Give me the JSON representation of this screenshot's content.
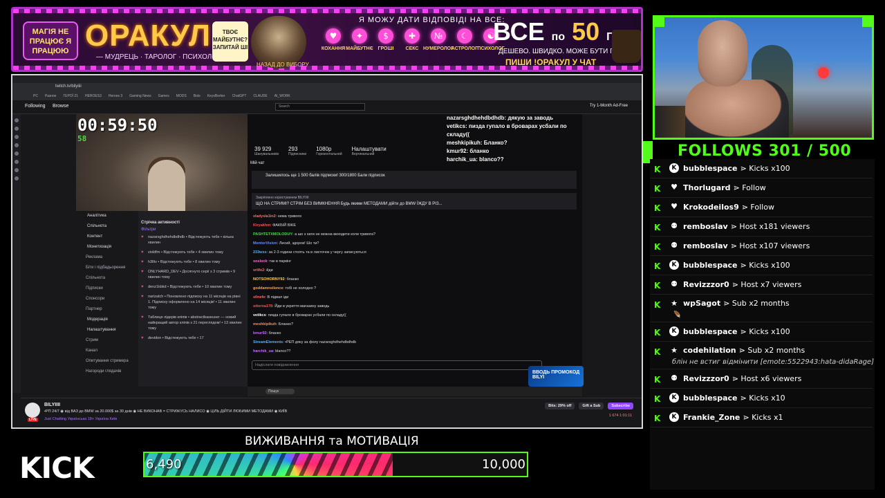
{
  "banner": {
    "magic_text": "МАГІЯ НЕ ПРАЦЮЄ Я ПРАЦЮЮ",
    "oracle": "ОРАКУЛ",
    "subtitle": "— МУДРЕЦЬ · ТАРОЛОГ · ПСИХОЛОГ —",
    "bubble": "ТВОЄ МАЙБУТНЄ? ЗАПИТАЙ ШІ",
    "wizard_label": "НАЗАД ДО ВИБОРУ",
    "answer": "Я МОЖУ ДАТИ ВІДПОВІДІ НА ВСЕ:",
    "categories": [
      "КОХАННЯ",
      "МАЙБУТНЄ",
      "ГРОШІ",
      "СЕКС",
      "НУМЕРОЛОГ",
      "АСТРОЛОГ",
      "ПСИХОЛОГ"
    ],
    "price_all": "ВСЕ",
    "price_po": "по",
    "price_num": "50",
    "price_grn": "ГРН.",
    "fast": "ДЕШЕВО. ШВИДКО. МОЖЕ БУТИ ПРАВДА.",
    "write": "ПИШИ !ОРАКУЛ У ЧАТ"
  },
  "screen": {
    "address": "twitch.tv/bilyiiii",
    "bookmarks": [
      "PC",
      "Разное",
      "ГЕРОЇ 21",
      "HEROES3",
      "Heroes 3",
      "Gaming News",
      "Games",
      "MODS",
      "Bots",
      "KeysBorker",
      "ChatGPT",
      "CLAUDE",
      "AI_WORK"
    ],
    "nav_following": "Following",
    "nav_browse": "Browse",
    "search_placeholder": "Search",
    "ad_free": "Try 1-Month Ad-Free",
    "timer": "00:59:50",
    "fps": "58",
    "menu": [
      {
        "label": "Аналітика",
        "sub": false
      },
      {
        "label": "Спільнота",
        "sub": false
      },
      {
        "label": "Контент",
        "sub": false
      },
      {
        "label": "Монетизація",
        "sub": false
      },
      {
        "label": "Реклама",
        "sub": true
      },
      {
        "label": "Біти і підбадьорення",
        "sub": true
      },
      {
        "label": "Спільнота",
        "sub": true
      },
      {
        "label": "Підписки",
        "sub": true
      },
      {
        "label": "Спонсори",
        "sub": true
      },
      {
        "label": "Партнер",
        "sub": true
      },
      {
        "label": "Модерація",
        "sub": false
      },
      {
        "label": "Налаштування",
        "sub": false
      },
      {
        "label": "Стрим",
        "sub": true
      },
      {
        "label": "Канал",
        "sub": true
      },
      {
        "label": "Опитування стримера",
        "sub": true
      },
      {
        "label": "Нагороди глядачів",
        "sub": true
      }
    ],
    "activity_title": "Стрічка активності",
    "activity_filters": "Фільтри",
    "activity": [
      "nazarsghdhehdbdhdb • Відстежують тебе • кілька хвилин",
      "violdfm • Відстежують тебе • 4 хвилин тому",
      "h3lltv • Відстежують тебе • 8 хвилин тому",
      "ONLYHARD_DEV • Досягнуто серії з 3 стримів • 9 хвилин тому",
      "denz1kbkd • Відстежують тебе • 10 хвилин тому",
      "narizatch • Поновлено підписку на 11 місяців на рівні 1. Підписку оформлено на 14 місяців! • 11 хвилин тому",
      "Таблиця лідерів кліпів • abstractbaseuser — новий найкращий автор кліпів з 21 переглядом! • 13 хвилин тому",
      "devidon • Відстежують тебе • 17"
    ],
    "stats": [
      {
        "value": "39 929",
        "label": "Шанувальників"
      },
      {
        "value": "293",
        "label": "Підписники"
      },
      {
        "value": "1080p",
        "label": "Горизонтальний"
      },
      {
        "value": "Налаштувати",
        "label": "Вертикальний"
      }
    ],
    "chat_label": "Мій чат",
    "points": "Залишилось ще 1 500 балів підписки!  300/1800 Бали підписок",
    "pinned_label": "Закріплено користувачем BILYIIII",
    "pinned": "ЩО НА СТРИМІ? СТРІМ БЕЗ ВИМКНЕННЯ Будь якими МЕТОДАМИ дійти до BMW ЇЖДУ В РІЗ...",
    "messages": [
      {
        "user": "vladysla1in2",
        "text": "нема тривоги",
        "color": "#ff6b6b"
      },
      {
        "user": "Kiryakhm",
        "text": "ФАКБІЙ ВЖЕ",
        "color": "#ff4f4f"
      },
      {
        "user": "PASHTETXMOLODUY",
        "text": "а шо з хати не можна виходити коли тривога?",
        "color": "#4fd14f"
      },
      {
        "user": "MentorVision",
        "text": "Лисий, здоров! Шо ти?",
        "color": "#6b8cff"
      },
      {
        "user": "233wxs",
        "text": "за 2-3 години стоять та в листочок у чергу записуються",
        "color": "#4fb0ff"
      },
      {
        "user": "soslock",
        "text": "так в паркінг",
        "color": "#ff6bd6"
      },
      {
        "user": "vrlife2",
        "text": "йди",
        "color": "#ff6b6b"
      },
      {
        "user": "NOTSOHORNY92",
        "text": "бланко",
        "color": "#ffd24f"
      },
      {
        "user": "goddamnsilence",
        "text": "тобі не холодно ?",
        "color": "#ffa24f"
      },
      {
        "user": "s0nefe",
        "text": "В підвал іди",
        "color": "#ff6b6b"
      },
      {
        "user": "ottorna178",
        "text": "Йди в укриття магазину заводь",
        "color": "#ff4f4f"
      },
      {
        "user": "vetikcs",
        "text": "пизда гупало в броварах усбали по складу((",
        "color": "#ffffff"
      },
      {
        "user": "meshkipikuh",
        "text": "Бланко?",
        "color": "#ff8a4f"
      },
      {
        "user": "kmur92",
        "text": "бланко",
        "color": "#c36bff"
      },
      {
        "user": "StreamElements",
        "text": "•РЕП дяку за фолу nazarsghdhehdbdhdb",
        "color": "#4fb0ff"
      },
      {
        "user": "harchik_ua",
        "text": "blanco??",
        "color": "#c36bff"
      }
    ],
    "chat_placeholder": "Надіслати повідомлення",
    "overlay_chat": [
      "nazarsghdhehdbdhdb: дякую за заводь",
      "vetikcs: пизда гупало в броварах усбали по складу((",
      "meshkipikuh: Бланко?",
      "kmur92: бланко",
      "harchik_ua: blanco??"
    ],
    "taskbar_search": "Пошук",
    "promo": "ВВОДЬ ПРОМОКОД BILYI",
    "channel": "BILYIIII",
    "stream_title": "•РП 24/7 ◉ від ВАЗ до BMW за 20.000$ за 30 днів ◉ НЕ ВИКОНАВ = СТРИЖУСЬ НАЛИСО ◉ ЦІЛЬ ДІЙТИ ЛЮБИМИ МЕТОДАМИ ◉ КИЇВ",
    "category": "Just Chatting   Українська   18+   Україна   Київ",
    "bits_btn": "Bits: 29% off",
    "gift_btn": "Gift a Sub",
    "sub_btn": "Subscribe",
    "viewers": "1 674   1:01:11",
    "live_badge": "LIVE"
  },
  "follows": {
    "text": "FOLLOWS 301 / 500"
  },
  "events": [
    {
      "icon": "kick-icon",
      "glyph": "K",
      "name": "bubblespace",
      "action": "⋗ Kicks x100"
    },
    {
      "icon": "heart-icon",
      "glyph": "♥",
      "name": "Thorlugard",
      "action": "⋗ Follow"
    },
    {
      "icon": "heart-icon",
      "glyph": "♥",
      "name": "Krokodeilos9",
      "action": "⋗ Follow"
    },
    {
      "icon": "host-icon",
      "glyph": "⚉",
      "name": "remboslav",
      "action": "⋗ Host x181 viewers"
    },
    {
      "icon": "host-icon",
      "glyph": "⚉",
      "name": "remboslav",
      "action": "⋗ Host x107 viewers"
    },
    {
      "icon": "kick-icon",
      "glyph": "K",
      "name": "bubblespace",
      "action": "⋗ Kicks x100"
    },
    {
      "icon": "host-icon",
      "glyph": "⚉",
      "name": "Revizzzor0",
      "action": "⋗ Host x7 viewers"
    },
    {
      "icon": "star-icon",
      "glyph": "★",
      "name": "wpSagot",
      "action": "⋗ Sub x2 months",
      "message": "🪶"
    },
    {
      "icon": "kick-icon",
      "glyph": "K",
      "name": "bubblespace",
      "action": "⋗ Kicks x100"
    },
    {
      "icon": "star-icon",
      "glyph": "★",
      "name": "codehilation",
      "action": "⋗ Sub x2 months",
      "message": "блін не встиг відмінити [emote:5522943:hata-didaRage]"
    },
    {
      "icon": "host-icon",
      "glyph": "⚉",
      "name": "Revizzzor0",
      "action": "⋗ Host x6 viewers"
    },
    {
      "icon": "kick-icon",
      "glyph": "K",
      "name": "bubblespace",
      "action": "⋗ Kicks x10"
    },
    {
      "icon": "kick-icon",
      "glyph": "K",
      "name": "Frankie_Zone",
      "action": "⋗ Kicks x1"
    }
  ],
  "goal": {
    "title": "ВИЖИВАННЯ та МОТИВАЦІЯ",
    "current": "6,490",
    "target": "10,000",
    "current_value": 6490,
    "target_value": 10000
  },
  "kick_logo": "KICK",
  "colors": {
    "accent": "#53fc18",
    "banner_border": "#b033c9",
    "twitch_purple": "#9147ff"
  }
}
